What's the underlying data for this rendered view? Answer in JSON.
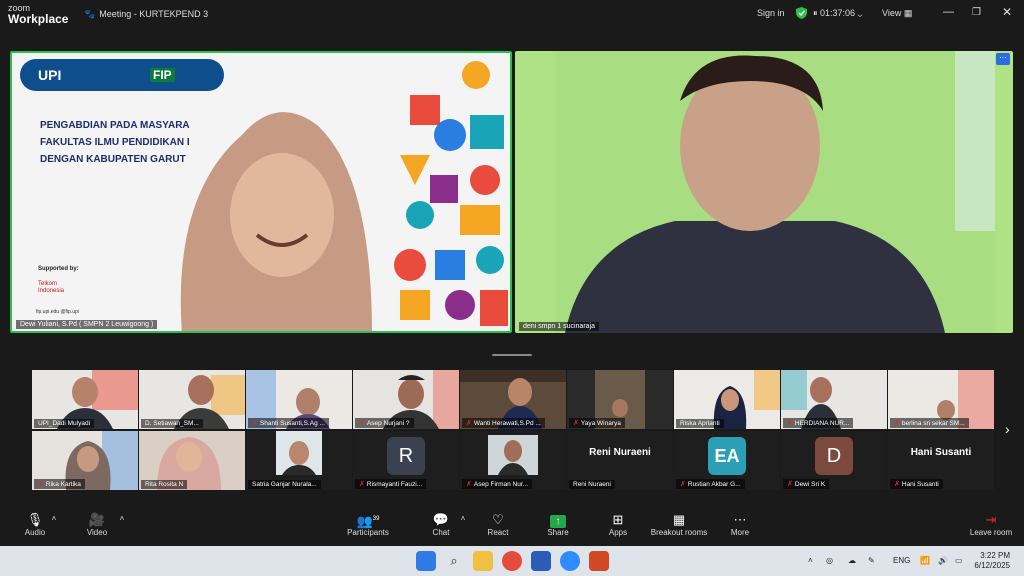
{
  "app": {
    "brand_top": "zoom",
    "brand_bottom": "Workplace",
    "meeting_title": "Meeting - KURTEKPEND 3"
  },
  "titlebar": {
    "sign_in": "Sign in",
    "timer": "01:37:06",
    "view": "View"
  },
  "main": {
    "speaker1": {
      "name": "Dewi Yuliani, S.Pd ( SMPN 2 Leuwigoong )",
      "slide_line1": "PENGABDIAN PADA MASYARA",
      "slide_line2": "FAKULTAS ILMU PENDIDIKAN I",
      "slide_line3": "DENGAN KABUPATEN GARUT",
      "supported_by": "Supported by:",
      "logo_upi": "UPI",
      "logo_fip": "FIP",
      "sponsor": "Telkom Indonesia",
      "footer_url": "fip.upi.edu",
      "footer_handle": "@fip.upi"
    },
    "speaker2": {
      "name": "deni smpn 1 sucinaraja"
    }
  },
  "gallery": {
    "row1": [
      {
        "name": "UPI_Dadi Mulyadi",
        "muted": false
      },
      {
        "name": "D. Setiawan_SM...",
        "muted": false
      },
      {
        "name": "Shanti Susanti,S.Ag ...",
        "muted": true
      },
      {
        "name": "Asep Nurjani ?",
        "muted": true
      },
      {
        "name": "Wanti Herawati,S.Pd ...",
        "muted": true
      },
      {
        "name": "Yaya Winarya",
        "muted": true
      },
      {
        "name": "Riska Aprianti",
        "muted": false
      },
      {
        "name": "HERDIANA NUR...",
        "muted": true
      },
      {
        "name": "berlina sri sekar SM...",
        "muted": true
      }
    ],
    "row2": [
      {
        "name": "Rika Kartika",
        "muted": true
      },
      {
        "name": "Rita Rosita N",
        "muted": false
      },
      {
        "name": "Satria Ganjar Nurala...",
        "muted": false
      },
      {
        "name": "Rismayanti Fauzi...",
        "muted": true,
        "initial": "R"
      },
      {
        "name": "Asep Firman Nur...",
        "muted": true
      },
      {
        "name": "Reni Nuraeni",
        "muted": false,
        "bigname": "Reni Nuraeni"
      },
      {
        "name": "Rustian Akbar G...",
        "muted": true,
        "initial": "EA"
      },
      {
        "name": "Dewi Sri K",
        "muted": true,
        "initial": "D"
      },
      {
        "name": "Hani Susanti",
        "muted": true,
        "bigname": "Hani Susanti"
      }
    ]
  },
  "toolbar": {
    "audio": "Audio",
    "video": "Video",
    "participants": "Participants",
    "participants_count": "39",
    "chat": "Chat",
    "react": "React",
    "share": "Share",
    "apps": "Apps",
    "breakout": "Breakout rooms",
    "more": "More",
    "leave": "Leave room"
  },
  "taskbar": {
    "lang": "ENG",
    "time": "3:22 PM",
    "date": "6/12/2025"
  },
  "colors": {
    "accent_green": "#2bc04a",
    "share_green": "#23a94a",
    "muted_red": "#e02828",
    "avatar_brown": "#7b4a3c",
    "avatar_gray": "#3a4250",
    "ea_teal": "#2a9fb5"
  }
}
